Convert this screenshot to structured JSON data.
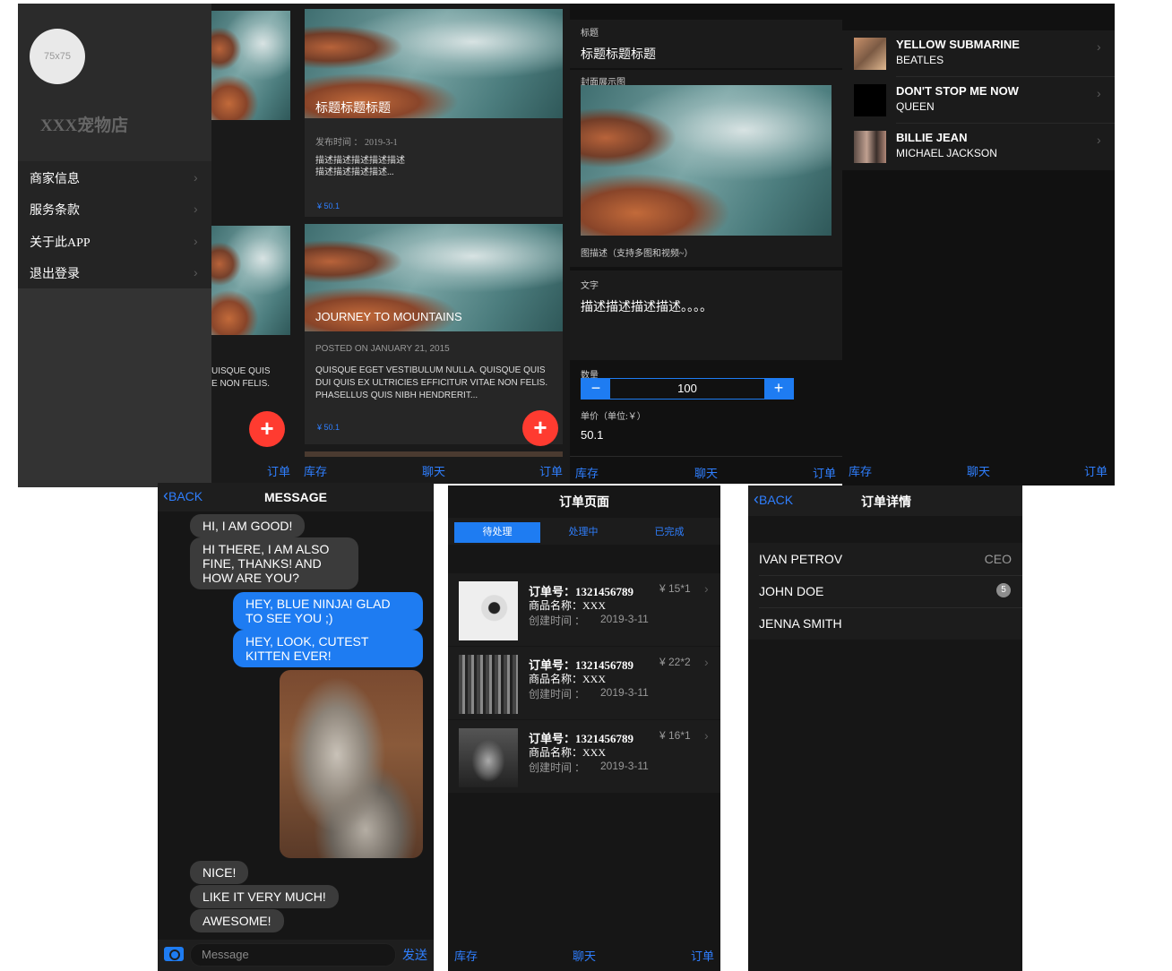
{
  "panel1": {
    "avatar_text": "75x75",
    "store_name": "XXX宠物店",
    "menu": [
      {
        "label": "商家信息"
      },
      {
        "label": "服务条款"
      },
      {
        "label": "关于此APP"
      },
      {
        "label": "退出登录"
      }
    ],
    "peek_text": "UISQUE QUIS\nE NON FELIS.",
    "tab_order": "订单",
    "fab": "+"
  },
  "panel2": {
    "card1": {
      "title": "标题标题标题",
      "date": "发布时间 ： 2019-3-1",
      "desc": "描述描述描述描述描述\n描述描述描述描述...",
      "price": "¥ 50.1"
    },
    "card2": {
      "title": "JOURNEY TO MOUNTAINS",
      "date": "POSTED ON JANUARY 21, 2015",
      "desc": "QUISQUE EGET VESTIBULUM NULLA. QUISQUE QUIS DUI QUIS EX ULTRICIES EFFICITUR VITAE NON FELIS. PHASELLUS QUIS NIBH HENDRERIT...",
      "price": "¥ 50.1"
    },
    "fab": "+",
    "tabs": [
      "库存",
      "聊天",
      "订单"
    ]
  },
  "panel3": {
    "label_title": "标题",
    "title_value": "标题标题标题",
    "label_cover": "封面展示图",
    "cover_caption": "图描述（支持多图和视频~）",
    "label_text": "文字",
    "text_value": "描述描述描述描述。。。。",
    "label_qty": "数量",
    "qty_minus": "−",
    "qty_value": "100",
    "qty_plus": "+",
    "label_price": "单价（单位:￥）",
    "price_value": "50.1",
    "tabs": [
      "库存",
      "聊天",
      "订单"
    ]
  },
  "panel4": {
    "songs": [
      {
        "title": "YELLOW SUBMARINE",
        "artist": "BEATLES"
      },
      {
        "title": "DON'T STOP ME NOW",
        "artist": "QUEEN"
      },
      {
        "title": "BILLIE JEAN",
        "artist": "MICHAEL JACKSON"
      }
    ],
    "tabs": [
      "库存",
      "聊天",
      "订单"
    ]
  },
  "messages": {
    "back": "BACK",
    "title": "MESSAGE",
    "items": [
      {
        "side": "left",
        "text": "HI, I AM GOOD!"
      },
      {
        "side": "left",
        "text": "HI THERE, I AM ALSO FINE, THANKS! AND HOW ARE YOU?"
      },
      {
        "side": "right",
        "text": "HEY, BLUE NINJA! GLAD TO SEE YOU ;)"
      },
      {
        "side": "right",
        "text": "HEY, LOOK, CUTEST KITTEN EVER!"
      },
      {
        "side": "left",
        "text": "NICE!"
      },
      {
        "side": "left",
        "text": "LIKE IT VERY MUCH!"
      },
      {
        "side": "left",
        "text": "AWESOME!"
      }
    ],
    "input_placeholder": "Message",
    "send": "发送"
  },
  "orders": {
    "title": "订单页面",
    "segments": [
      "待处理",
      "处理中",
      "已完成"
    ],
    "active_segment": 0,
    "items": [
      {
        "no": "订单号：1321456789",
        "price": "¥ 15*1",
        "name": "商品名称：XXX",
        "time_label": "创建时间 ：",
        "time": "2019-3-11"
      },
      {
        "no": "订单号：1321456789",
        "price": "¥ 22*2",
        "name": "商品名称：XXX",
        "time_label": "创建时间 ：",
        "time": "2019-3-11"
      },
      {
        "no": "订单号：1321456789",
        "price": "¥ 16*1",
        "name": "商品名称：XXX",
        "time_label": "创建时间 ：",
        "time": "2019-3-11"
      }
    ],
    "tabs": [
      "库存",
      "聊天",
      "订单"
    ]
  },
  "detail": {
    "back": "BACK",
    "title": "订单详情",
    "rows": [
      {
        "name": "IVAN PETROV",
        "right": "CEO"
      },
      {
        "name": "JOHN DOE",
        "right": "5"
      },
      {
        "name": "JENNA SMITH",
        "right": ""
      }
    ]
  },
  "colors": {
    "accent": "#2f7fff",
    "fab": "#ff3b30",
    "bg": "#111111",
    "card": "#1e1e1e"
  }
}
